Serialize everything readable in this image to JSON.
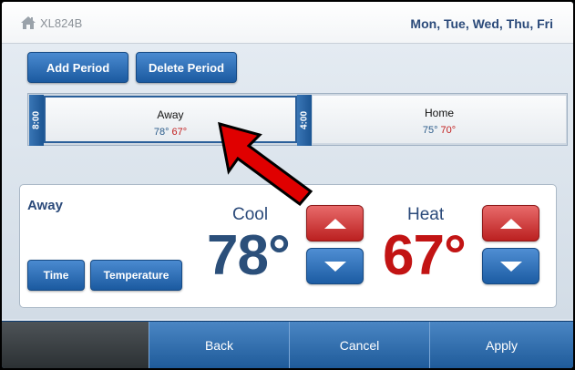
{
  "header": {
    "icon": "home-icon",
    "model": "XL824B",
    "days": "Mon, Tue, Wed, Thu, Fri"
  },
  "toolbar": {
    "add_period": "Add Period",
    "delete_period": "Delete Period"
  },
  "timeline": {
    "handles": [
      "8:00",
      "4:00"
    ],
    "periods": [
      {
        "name": "Away",
        "cool": "78°",
        "heat": "67°",
        "selected": true
      },
      {
        "name": "Home",
        "cool": "75°",
        "heat": "70°",
        "selected": false
      }
    ]
  },
  "detail": {
    "title": "Away",
    "time_button": "Time",
    "temperature_button": "Temperature",
    "cool_label": "Cool",
    "cool_value": "78°",
    "heat_label": "Heat",
    "heat_value": "67°"
  },
  "footer": {
    "back": "Back",
    "cancel": "Cancel",
    "apply": "Apply"
  },
  "colors": {
    "accent_blue": "#1b5aa0",
    "heat_red": "#c21414",
    "cool_blue": "#2b4f7a",
    "annotation_red": "#e00000"
  }
}
